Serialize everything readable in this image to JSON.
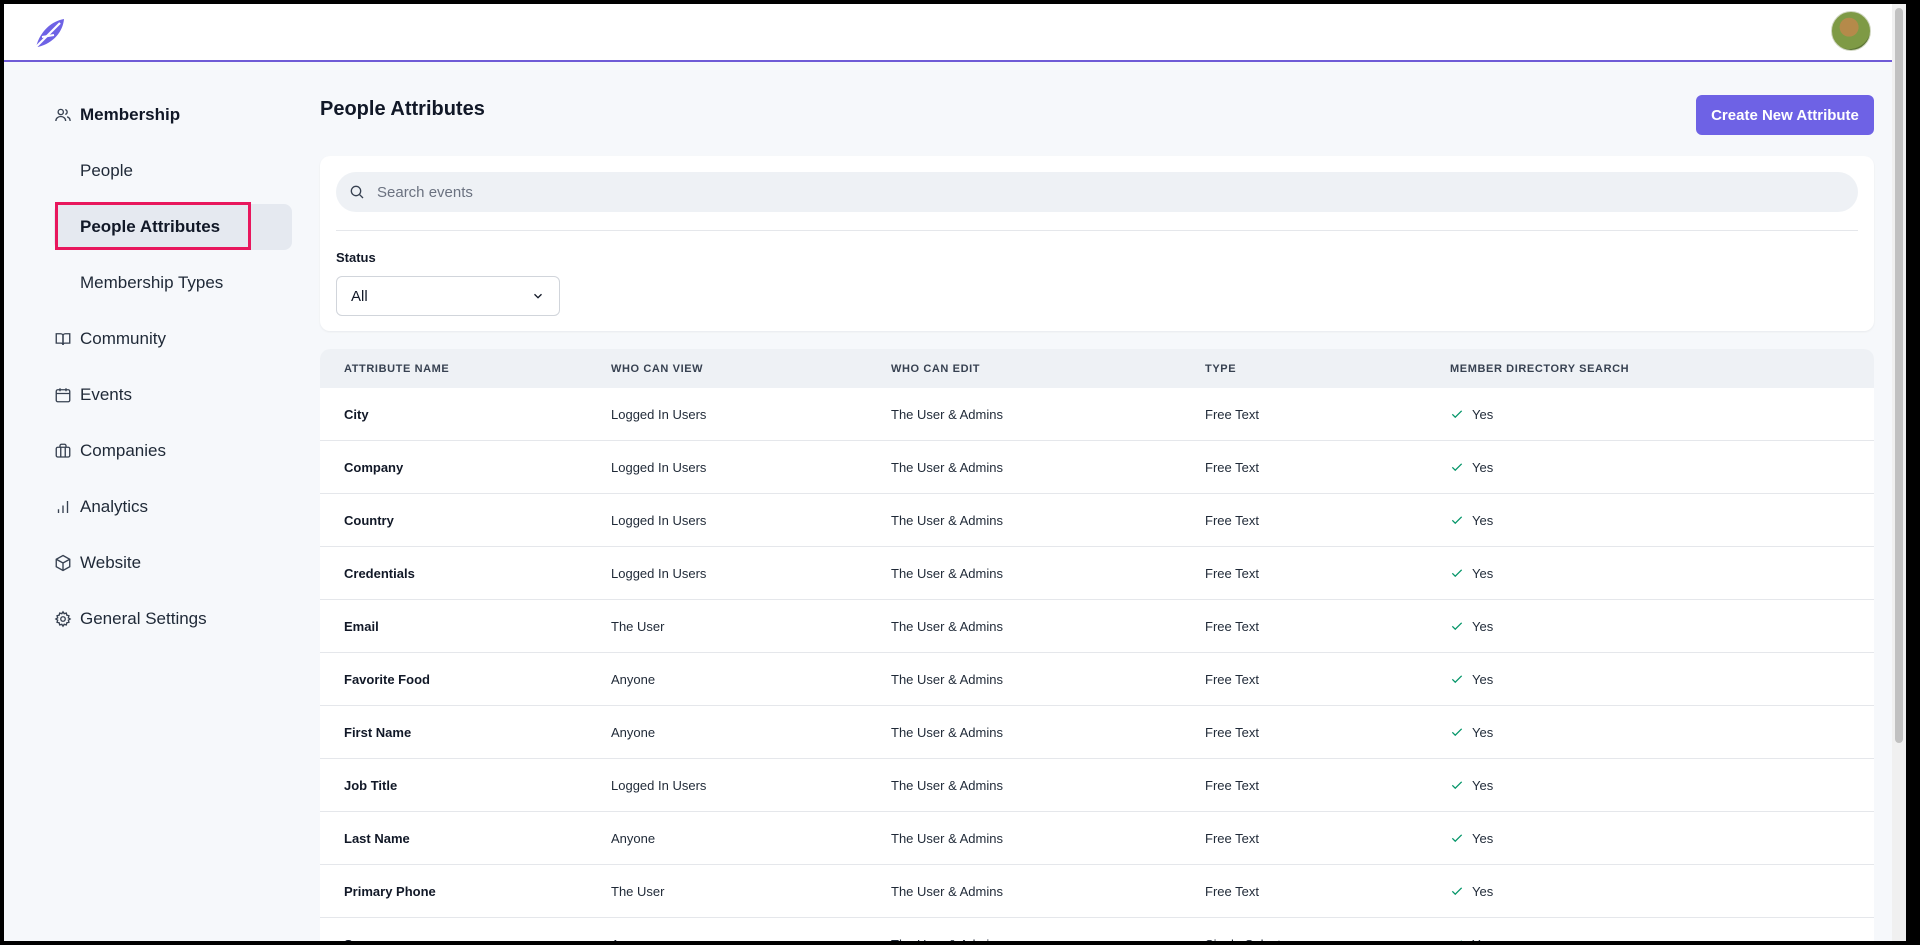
{
  "colors": {
    "accent": "#6e62e5",
    "highlight": "#e8175d",
    "check": "#059669"
  },
  "sidebar": {
    "items": [
      {
        "label": "Membership",
        "icon": "users-icon"
      },
      {
        "label": "People"
      },
      {
        "label": "People Attributes"
      },
      {
        "label": "Membership Types"
      },
      {
        "label": "Community",
        "icon": "book-icon"
      },
      {
        "label": "Events",
        "icon": "calendar-icon"
      },
      {
        "label": "Companies",
        "icon": "briefcase-icon"
      },
      {
        "label": "Analytics",
        "icon": "bar-chart-icon"
      },
      {
        "label": "Website",
        "icon": "cube-icon"
      },
      {
        "label": "General Settings",
        "icon": "gear-icon"
      }
    ]
  },
  "main": {
    "title": "People Attributes",
    "create_button": "Create New Attribute",
    "search": {
      "placeholder": "Search events",
      "value": ""
    },
    "status": {
      "label": "Status",
      "selected": "All"
    }
  },
  "table": {
    "headers": [
      "ATTRIBUTE NAME",
      "WHO CAN VIEW",
      "WHO CAN EDIT",
      "TYPE",
      "MEMBER DIRECTORY SEARCH"
    ],
    "rows": [
      [
        "City",
        "Logged In Users",
        "The User & Admins",
        "Free Text",
        "Yes"
      ],
      [
        "Company",
        "Logged In Users",
        "The User & Admins",
        "Free Text",
        "Yes"
      ],
      [
        "Country",
        "Logged In Users",
        "The User & Admins",
        "Free Text",
        "Yes"
      ],
      [
        "Credentials",
        "Logged In Users",
        "The User & Admins",
        "Free Text",
        "Yes"
      ],
      [
        "Email",
        "The User",
        "The User & Admins",
        "Free Text",
        "Yes"
      ],
      [
        "Favorite Food",
        "Anyone",
        "The User & Admins",
        "Free Text",
        "Yes"
      ],
      [
        "First Name",
        "Anyone",
        "The User & Admins",
        "Free Text",
        "Yes"
      ],
      [
        "Job Title",
        "Logged In Users",
        "The User & Admins",
        "Free Text",
        "Yes"
      ],
      [
        "Last Name",
        "Anyone",
        "The User & Admins",
        "Free Text",
        "Yes"
      ],
      [
        "Primary Phone",
        "The User",
        "The User & Admins",
        "Free Text",
        "Yes"
      ],
      [
        "Sex",
        "Anyone",
        "The User & Admins",
        "Single Select",
        "Yes"
      ]
    ]
  }
}
